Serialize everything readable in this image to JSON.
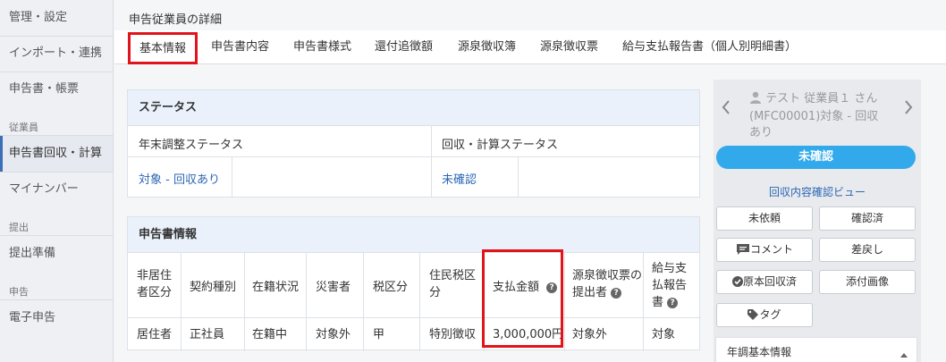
{
  "sidebar": {
    "items": [
      "管理・設定",
      "インポート・連携",
      "申告書・帳票",
      "申告書回収・計算",
      "マイナンバー",
      "提出準備",
      "電子申告"
    ],
    "sections": [
      "従業員",
      "提出",
      "申告"
    ]
  },
  "page": {
    "title": "申告従業員の詳細"
  },
  "tabs": [
    "基本情報",
    "申告書内容",
    "申告書様式",
    "還付追徴額",
    "源泉徴収簿",
    "源泉徴収票",
    "給与支払報告書（個人別明細書）"
  ],
  "status": {
    "heading": "ステータス",
    "col1_label": "年末調整ステータス",
    "col2_label": "回収・計算ステータス",
    "col1_value": "対象 - 回収あり",
    "col2_value": "未確認"
  },
  "decl": {
    "heading": "申告書情報",
    "headers": [
      "非居住者区分",
      "契約種別",
      "在籍状況",
      "災害者",
      "税区分",
      "住民税区分",
      "支払金額",
      "源泉徴収票の提出者",
      "給与支払報告書"
    ],
    "values": [
      "居住者",
      "正社員",
      "在籍中",
      "対象外",
      "甲",
      "特別徴収",
      "3,000,000円",
      "対象外",
      "対象"
    ],
    "help": "?"
  },
  "employee": {
    "name": "テスト 従業員１ さん",
    "code_status": "(MFC00001)対象 - 回収あり",
    "status_button": "未確認",
    "viewer_link": "回収内容確認ビュー"
  },
  "buttons": {
    "unrequested": "未依頼",
    "confirmed": "確認済",
    "comment": "コメント",
    "sendback": "差戻し",
    "original_collected": "原本回収済",
    "attachment": "添付画像",
    "tag": "タグ"
  },
  "accordion": {
    "label": "年調基本情報"
  },
  "icons": {
    "user": "user-icon",
    "prev": "chevron-left-icon",
    "next": "chevron-right-icon",
    "comment": "comment-icon",
    "check": "check-circle-icon",
    "tag": "tag-icon",
    "caret": "caret-up-icon"
  }
}
